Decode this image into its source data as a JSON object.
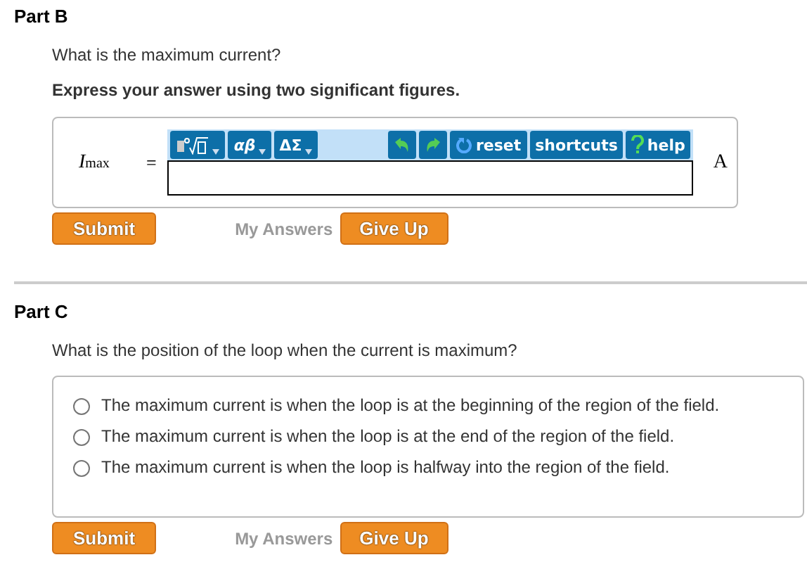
{
  "parts": [
    {
      "kind": "numeric",
      "title": "Part B",
      "question": "What is the maximum current?",
      "instruction": "Express your answer using two significant figures.",
      "variable": "I",
      "subscript": "max",
      "equals": "=",
      "toolbar": {
        "greek": "αβ",
        "symbols": "ΔΣ",
        "reset": "reset",
        "shortcuts": "shortcuts",
        "help": "help"
      },
      "unit": "A",
      "actions": {
        "submit": "Submit",
        "my_answers": "My Answers",
        "give_up": "Give Up"
      }
    },
    {
      "kind": "choice",
      "title": "Part C",
      "question": "What is the position of the loop when the current is maximum?",
      "options": [
        {
          "label": "The maximum current is when the loop is at the beginning of the region of the field.",
          "selected": false
        },
        {
          "label": "The maximum current is when the loop is at the end of the region of the field.",
          "selected": false
        },
        {
          "label": "The maximum current is when the loop is halfway into the region of the field.",
          "selected": false
        }
      ],
      "actions": {
        "submit": "Submit",
        "my_answers": "My Answers",
        "give_up": "Give Up"
      }
    }
  ]
}
